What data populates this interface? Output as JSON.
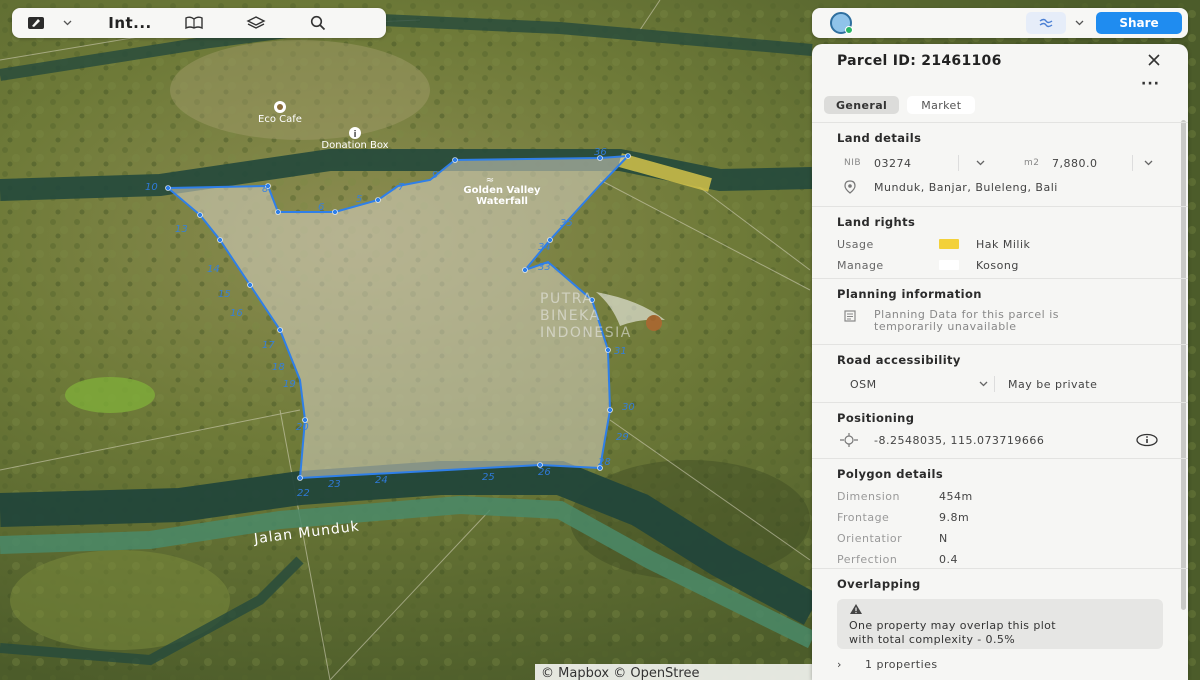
{
  "toolbar": {
    "title": "Int...",
    "icons": [
      "pencil-icon",
      "chevron-down-icon",
      "book-icon",
      "layers-icon",
      "search-icon"
    ]
  },
  "topbar": {
    "share_label": "Share",
    "icons": [
      "avatar",
      "satellite-layers-icon",
      "chevron-down-icon"
    ]
  },
  "map": {
    "pois": [
      {
        "label": "Eco Cafe",
        "icon": "cafe-icon"
      },
      {
        "label": "Donation Box",
        "icon": "info-icon"
      },
      {
        "label": "Golden Valley\nWaterfall",
        "icon": "waterfall-icon"
      }
    ],
    "road_label": "Jalan Munduk",
    "watermark": [
      "PUTRA",
      "BINEKA",
      "INDONESIA"
    ],
    "attribution": "© Mapbox © OpenStree",
    "vertex_numbers": [
      "10",
      "13",
      "14",
      "15",
      "16",
      "17",
      "18",
      "19",
      "20",
      "22",
      "23",
      "24",
      "25",
      "26",
      "28",
      "29",
      "30",
      "31",
      "33",
      "34",
      "35",
      "36",
      "5",
      "6",
      "7",
      "8",
      "9"
    ],
    "colors": {
      "parcel_outline": "#2f7fe8",
      "parcel_fill": "#d8d4c4",
      "road": "#254a3c"
    }
  },
  "panel": {
    "title": "Parcel ID: 21461106",
    "tabs": [
      {
        "label": "General",
        "active": true
      },
      {
        "label": "Market",
        "active": false
      }
    ],
    "land_details": {
      "title": "Land details",
      "nib_label": "NIB",
      "nib_value": "03274",
      "area_unit": "m2",
      "area_value": "7,880.0",
      "location": "Munduk, Banjar, Buleleng, Bali"
    },
    "land_rights": {
      "title": "Land rights",
      "usage_label": "Usage",
      "usage_value": "Hak Milik",
      "usage_color": "#f3d13a",
      "manage_label": "Manage",
      "manage_value": "Kosong",
      "manage_color": "#ffffff"
    },
    "planning": {
      "title": "Planning information",
      "line1": "Planning Data for this parcel is",
      "line2": "temporarily unavailable"
    },
    "road": {
      "title": "Road accessibility",
      "source": "OSM",
      "status": "May be private"
    },
    "positioning": {
      "title": "Positioning",
      "coords": "-8.2548035, 115.073719666"
    },
    "polygon": {
      "title": "Polygon details",
      "rows": [
        {
          "label": "Dimension",
          "value": "454m"
        },
        {
          "label": "Frontage",
          "value": "9.8m"
        },
        {
          "label": "Orientatior",
          "value": "N"
        },
        {
          "label": "Perfection",
          "value": "0.4"
        }
      ]
    },
    "overlapping": {
      "title": "Overlapping",
      "line1": "One property may overlap this plot",
      "line2": "with total complexity - 0.5%",
      "properties_label": "1 properties"
    }
  }
}
